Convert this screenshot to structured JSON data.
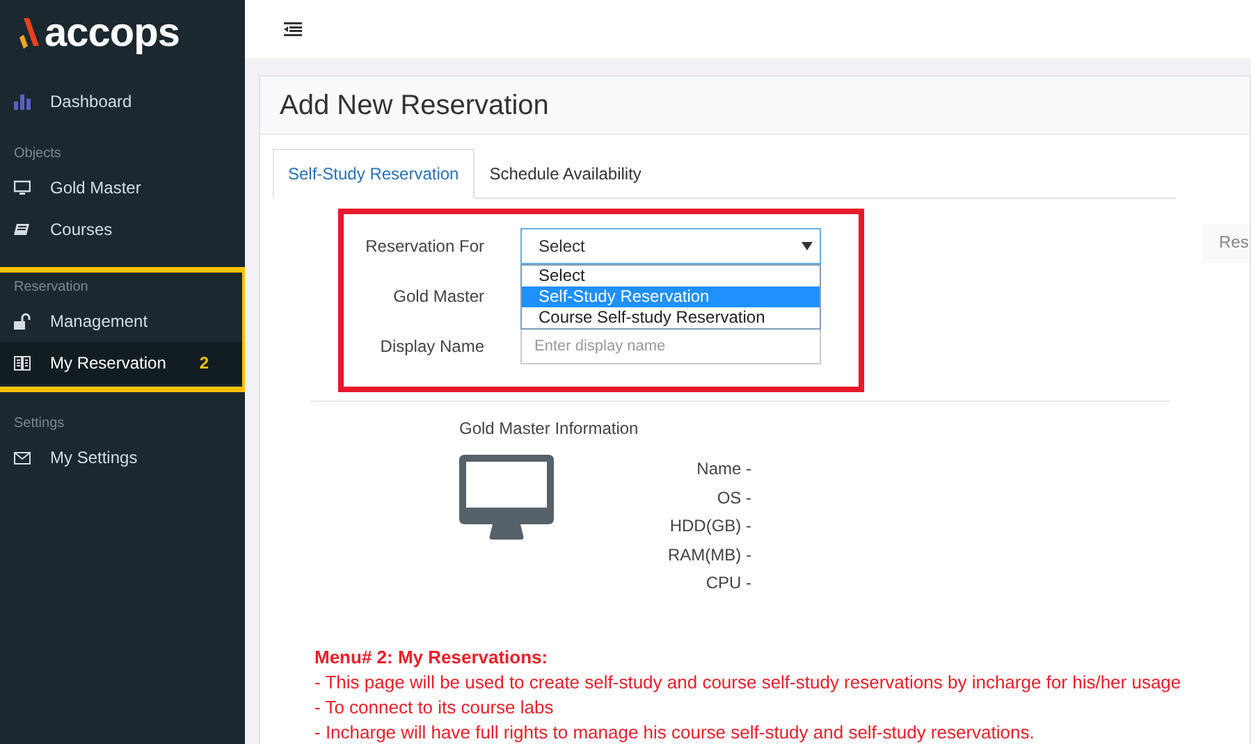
{
  "logo": "accops",
  "sidebar": {
    "sections": [
      {
        "items": [
          {
            "label": "Dashboard",
            "selected": false
          }
        ]
      },
      {
        "heading": "Objects",
        "items": [
          {
            "label": "Gold Master",
            "selected": false
          },
          {
            "label": "Courses",
            "selected": false
          }
        ]
      },
      {
        "heading": "Reservation",
        "highlighted": true,
        "items": [
          {
            "label": "Management",
            "selected": false
          },
          {
            "label": "My Reservation",
            "selected": true,
            "badge": "2"
          }
        ]
      },
      {
        "heading": "Settings",
        "items": [
          {
            "label": "My Settings",
            "selected": false
          }
        ]
      }
    ]
  },
  "page_title": "Add New Reservation",
  "tabs": [
    {
      "label": "Self-Study Reservation",
      "selected": true
    },
    {
      "label": "Schedule Availability",
      "selected": false
    }
  ],
  "form": {
    "highlighted": true,
    "reservation_for": {
      "label": "Reservation For",
      "value": "Select",
      "expanded": true,
      "options": [
        {
          "label": "Select",
          "highlighted": false
        },
        {
          "label": "Self-Study Reservation",
          "highlighted": true
        },
        {
          "label": "Course Self-study Reservation",
          "highlighted": false
        }
      ]
    },
    "gold_master": {
      "label": "Gold Master"
    },
    "display_name": {
      "label": "Display Name",
      "placeholder": "Enter display name"
    }
  },
  "side_panel_text": "Res",
  "gold_master_info": {
    "title": "Gold Master Information",
    "fields": [
      "Name -",
      "OS -",
      "HDD(GB) -",
      "RAM(MB) -",
      "CPU -"
    ]
  },
  "annotation": {
    "title": "Menu# 2: My Reservations:",
    "lines": [
      "- This page will be used to create self-study and course self-study reservations by incharge for his/her usage",
      "- To connect to its course labs",
      "- Incharge will have full rights to manage his course self-study and self-study reservations."
    ]
  }
}
